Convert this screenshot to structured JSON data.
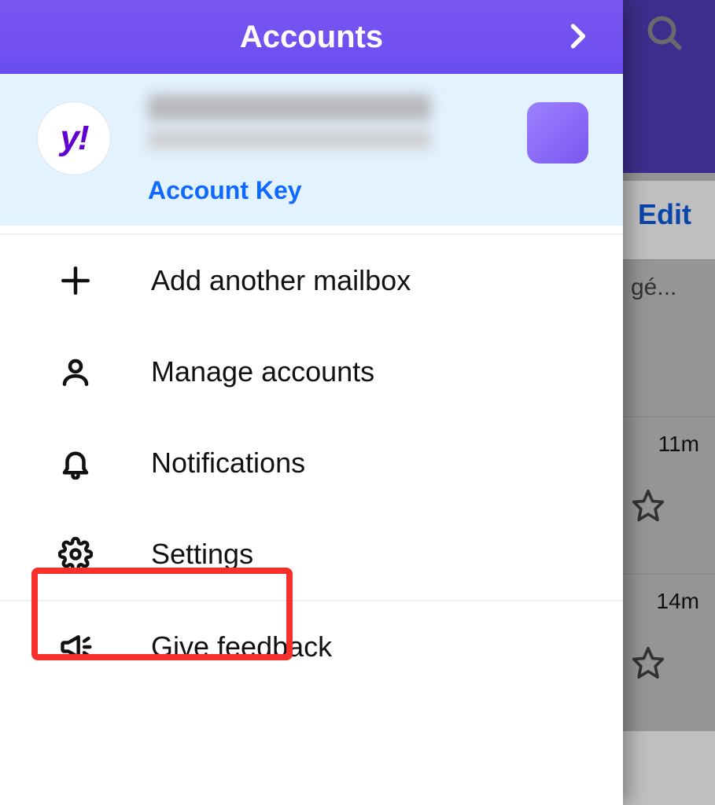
{
  "header": {
    "title": "Accounts"
  },
  "account": {
    "logo_text": "y!",
    "key_label": "Account Key"
  },
  "menu": {
    "add_mailbox": "Add another mailbox",
    "manage_accounts": "Manage accounts",
    "notifications": "Notifications",
    "settings": "Settings",
    "give_feedback": "Give feedback"
  },
  "background": {
    "edit_label": "Edit",
    "row1_snippet": "gé...",
    "row2_time": "11m",
    "row3_time": "14m"
  }
}
